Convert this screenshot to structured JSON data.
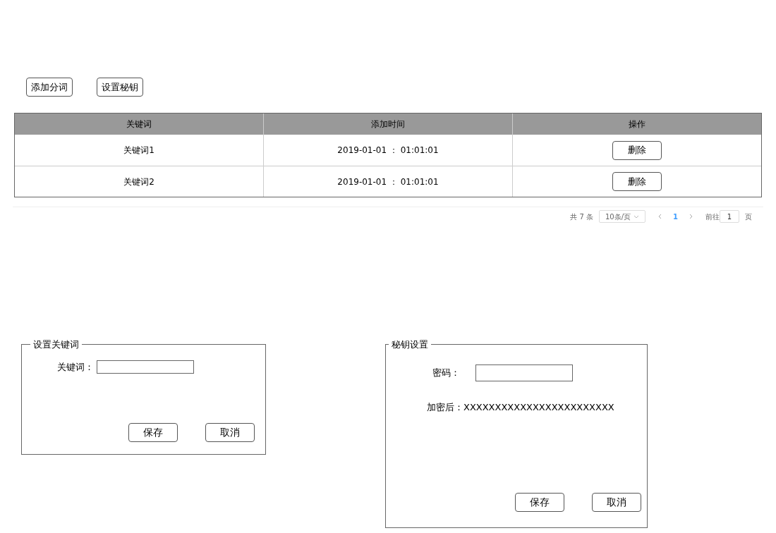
{
  "toolbar": [
    "添加分词",
    "设置秘钥"
  ],
  "table": {
    "columns": [
      "关键词",
      "添加时间",
      "操作"
    ],
    "rows": [
      {
        "keyword": "关键词1",
        "time": "2019-01-01 ： 01:01:01",
        "action": "删除"
      },
      {
        "keyword": "关键词2",
        "time": "2019-01-01 ： 01:01:01",
        "action": "删除"
      }
    ]
  },
  "pagination": {
    "total": "共 7 条",
    "page_size": "10条/页",
    "pages": [
      {
        "label": "1",
        "selected": true
      }
    ],
    "goto_label": "前往",
    "goto_value": "1",
    "goto_suffix": "页"
  },
  "keyword_panel": {
    "title": "设置关键词",
    "field_label": "关键词：",
    "buttons": [
      "保存",
      "取消"
    ]
  },
  "secret_panel": {
    "title": "秘钥设置",
    "field_label": "密码：",
    "result_label": "加密后：",
    "result_value": "XXXXXXXXXXXXXXXXXXXXXXXX",
    "buttons": [
      "保存",
      "取消"
    ]
  }
}
